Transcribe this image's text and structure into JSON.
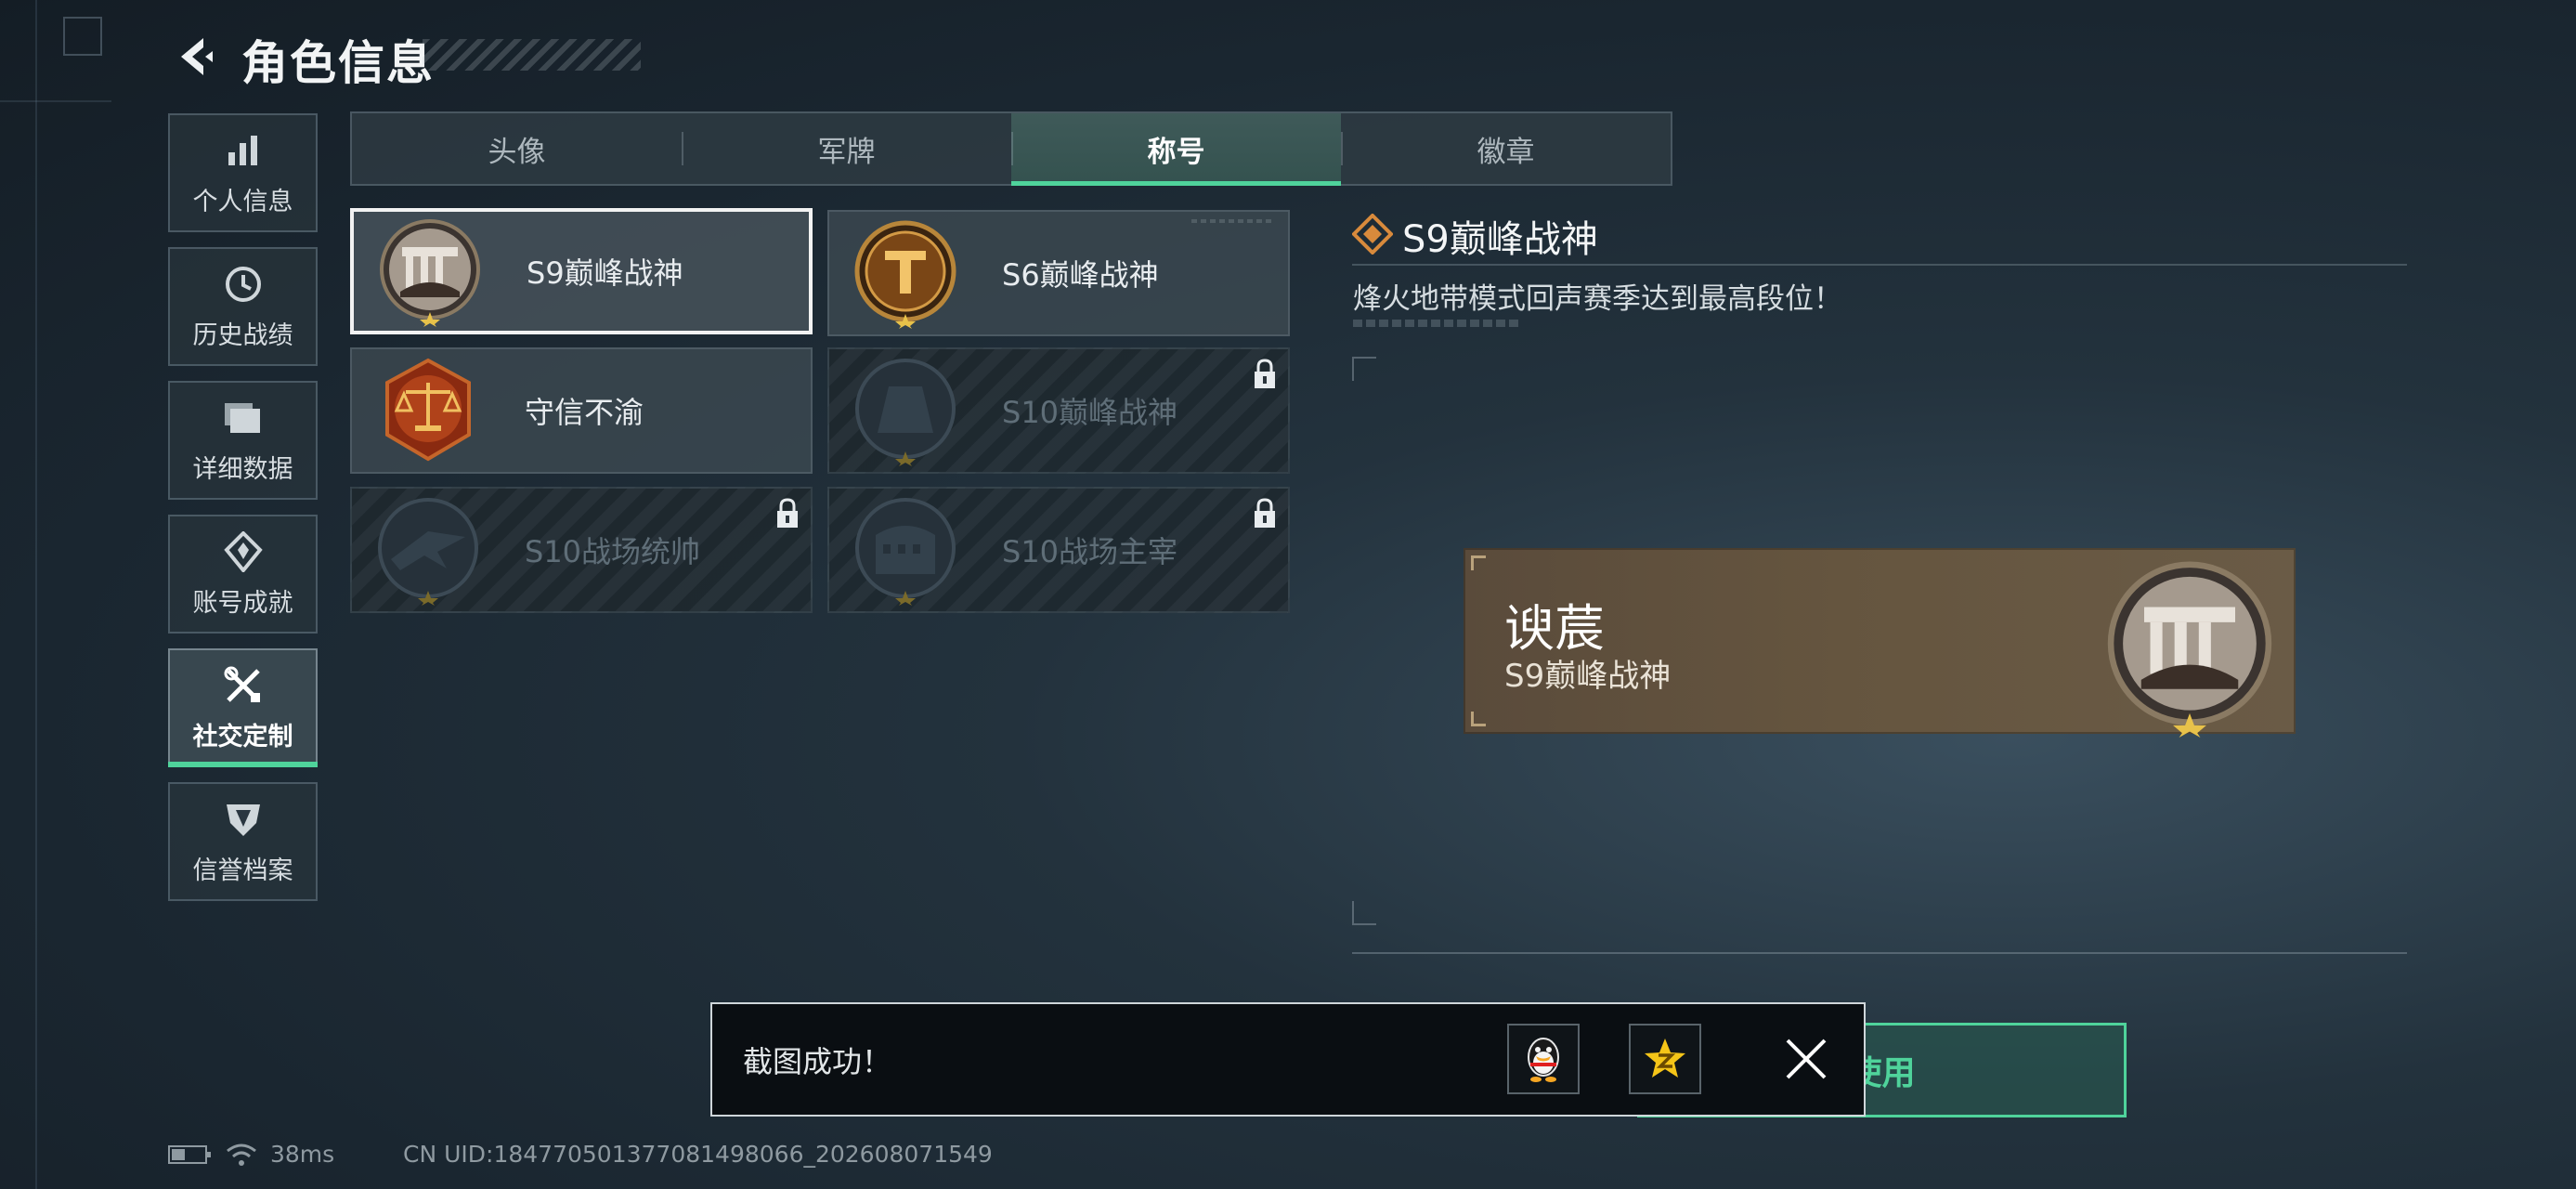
{
  "header": {
    "title": "角色信息"
  },
  "sidebar": {
    "items": [
      {
        "label": "个人信息",
        "icon": "bar-chart-icon"
      },
      {
        "label": "历史战绩",
        "icon": "history-clock-icon"
      },
      {
        "label": "详细数据",
        "icon": "folder-icon"
      },
      {
        "label": "账号成就",
        "icon": "achievement-icon"
      },
      {
        "label": "社交定制",
        "icon": "tools-icon",
        "active": true
      },
      {
        "label": "信誉档案",
        "icon": "reputation-shield-icon"
      }
    ]
  },
  "tabs": [
    {
      "label": "头像"
    },
    {
      "label": "军牌"
    },
    {
      "label": "称号",
      "active": true
    },
    {
      "label": "徽章"
    }
  ],
  "titles": [
    {
      "name": "S9巅峰战神",
      "badge": "s9-peak-badge",
      "state": "selected"
    },
    {
      "name": "S6巅峰战神",
      "badge": "s6-peak-badge",
      "state": "unlocked"
    },
    {
      "name": "守信不渝",
      "badge": "scales-badge",
      "state": "unlocked"
    },
    {
      "name": "S10巅峰战神",
      "badge": "s10-peak-badge",
      "state": "locked"
    },
    {
      "name": "S10战场统帅",
      "badge": "s10-commander-badge",
      "state": "locked"
    },
    {
      "name": "S10战场主宰",
      "badge": "s10-dominator-badge",
      "state": "locked"
    }
  ],
  "detail": {
    "title": "S9巅峰战神",
    "description": "烽火地带模式回声赛季达到最高段位！",
    "preview": {
      "player_name": "谀莀",
      "title": "S9巅峰战神"
    }
  },
  "use_button": {
    "label": "使用"
  },
  "toast": {
    "message": "截图成功！",
    "share_targets": [
      "qq-icon",
      "qzone-icon"
    ]
  },
  "status_bar": {
    "ping": "38ms",
    "uid": "CN UID:18477050137708149806​6_202608071549"
  },
  "colors": {
    "accent": "#4fd39b",
    "background": "#1a2630",
    "plate": "#65553f"
  }
}
